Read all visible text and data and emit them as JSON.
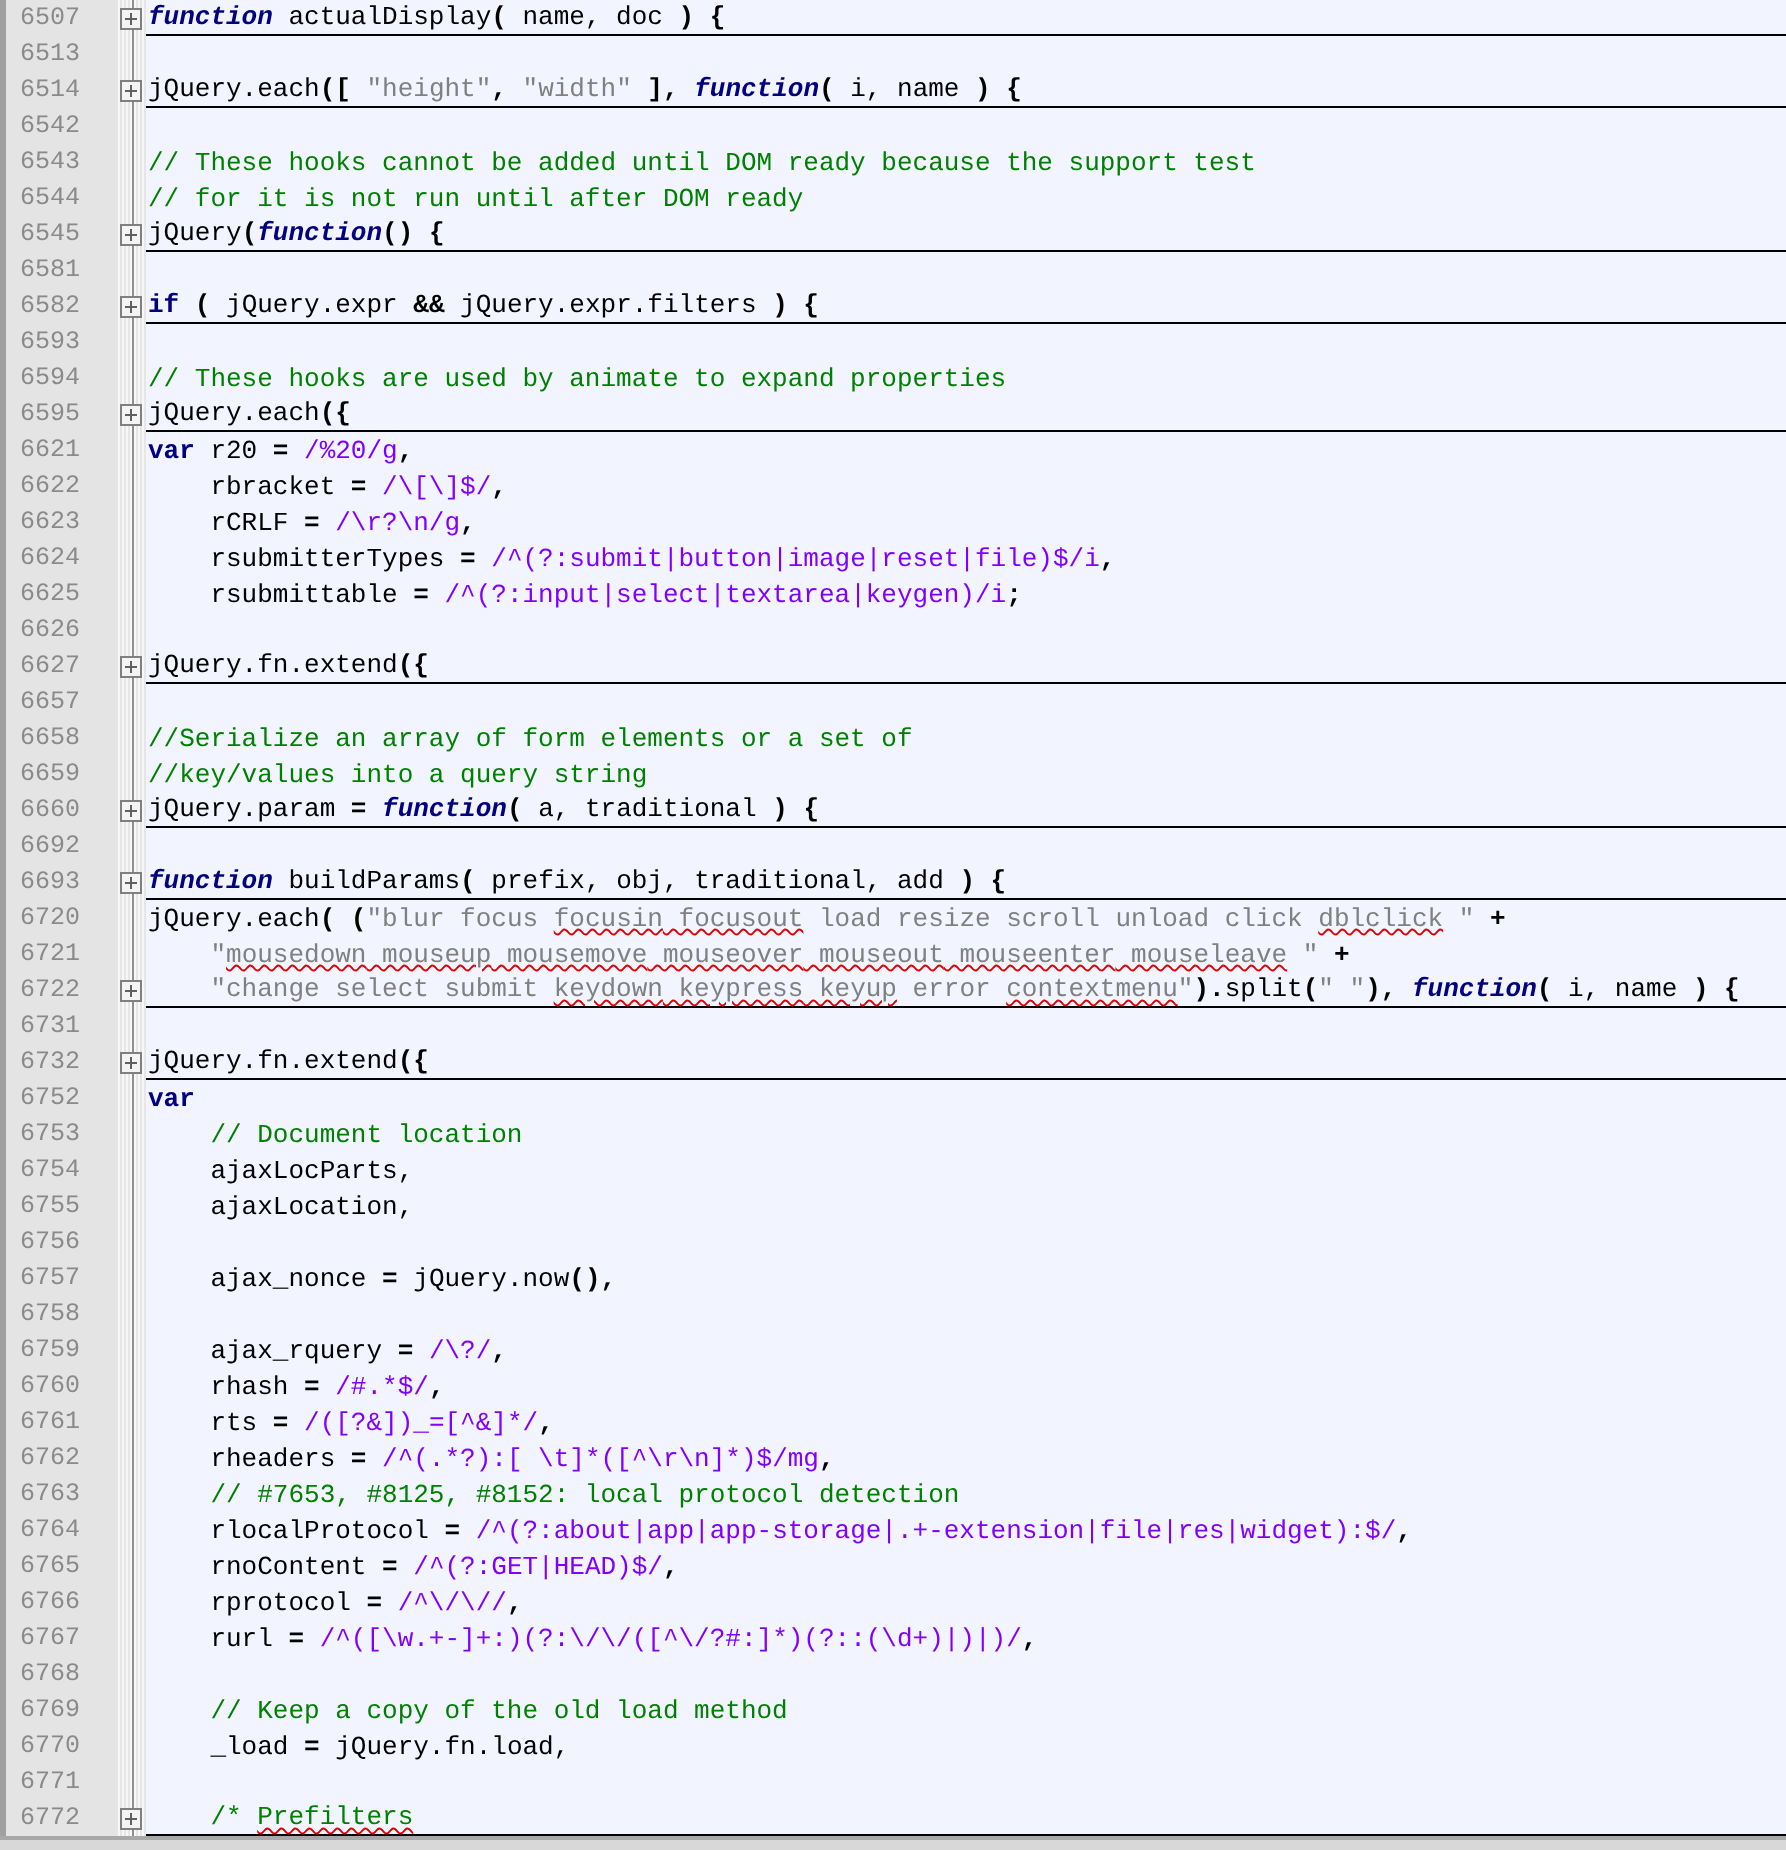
{
  "editor": {
    "lines": [
      {
        "number": "6507",
        "folded": true,
        "tokens": [
          {
            "kind": "fn-keyword",
            "text": "function"
          },
          {
            "kind": "plain",
            "text": " actualDisplay"
          },
          {
            "kind": "op",
            "text": "("
          },
          {
            "kind": "plain",
            "text": " name, doc "
          },
          {
            "kind": "op",
            "text": ") {"
          }
        ]
      },
      {
        "number": "6513",
        "folded": false
      },
      {
        "number": "6514",
        "folded": true,
        "tokens": [
          {
            "kind": "plain",
            "text": "jQuery.each"
          },
          {
            "kind": "op",
            "text": "([ "
          },
          {
            "kind": "string",
            "text": "\"height\""
          },
          {
            "kind": "op",
            "text": ", "
          },
          {
            "kind": "string",
            "text": "\"width\""
          },
          {
            "kind": "op",
            "text": " ], "
          },
          {
            "kind": "fn-keyword",
            "text": "function"
          },
          {
            "kind": "op",
            "text": "("
          },
          {
            "kind": "plain",
            "text": " i, name "
          },
          {
            "kind": "op",
            "text": ") {"
          }
        ]
      },
      {
        "number": "6542",
        "folded": false
      },
      {
        "number": "6543",
        "folded": false,
        "tokens": [
          {
            "kind": "comment",
            "text": "// These hooks cannot be added until DOM ready because the support test"
          }
        ]
      },
      {
        "number": "6544",
        "folded": false,
        "tokens": [
          {
            "kind": "comment",
            "text": "// for it is not run until after DOM ready"
          }
        ]
      },
      {
        "number": "6545",
        "folded": true,
        "tokens": [
          {
            "kind": "plain",
            "text": "jQuery"
          },
          {
            "kind": "op",
            "text": "("
          },
          {
            "kind": "fn-keyword",
            "text": "function"
          },
          {
            "kind": "op",
            "text": "() {"
          }
        ]
      },
      {
        "number": "6581",
        "folded": false
      },
      {
        "number": "6582",
        "folded": true,
        "tokens": [
          {
            "kind": "keyword",
            "text": "if"
          },
          {
            "kind": "op",
            "text": " ("
          },
          {
            "kind": "plain",
            "text": " jQuery.expr "
          },
          {
            "kind": "op",
            "text": "&&"
          },
          {
            "kind": "plain",
            "text": " jQuery.expr.filters "
          },
          {
            "kind": "op",
            "text": ") {"
          }
        ]
      },
      {
        "number": "6593",
        "folded": false
      },
      {
        "number": "6594",
        "folded": false,
        "tokens": [
          {
            "kind": "comment",
            "text": "// These hooks are used by animate to expand properties"
          }
        ]
      },
      {
        "number": "6595",
        "folded": true,
        "tokens": [
          {
            "kind": "plain",
            "text": "jQuery.each"
          },
          {
            "kind": "op",
            "text": "({"
          }
        ]
      },
      {
        "number": "6621",
        "folded": false,
        "tokens": [
          {
            "kind": "keyword",
            "text": "var"
          },
          {
            "kind": "plain",
            "text": " r20 "
          },
          {
            "kind": "op",
            "text": "= "
          },
          {
            "kind": "regex",
            "text": "/%20/g"
          },
          {
            "kind": "op",
            "text": ","
          }
        ]
      },
      {
        "number": "6622",
        "folded": false,
        "tokens": [
          {
            "kind": "plain",
            "text": "    rbracket "
          },
          {
            "kind": "op",
            "text": "= "
          },
          {
            "kind": "regex",
            "text": "/\\[\\]$/"
          },
          {
            "kind": "op",
            "text": ","
          }
        ]
      },
      {
        "number": "6623",
        "folded": false,
        "tokens": [
          {
            "kind": "plain",
            "text": "    rCRLF "
          },
          {
            "kind": "op",
            "text": "= "
          },
          {
            "kind": "regex",
            "text": "/\\r?\\n/g"
          },
          {
            "kind": "op",
            "text": ","
          }
        ]
      },
      {
        "number": "6624",
        "folded": false,
        "tokens": [
          {
            "kind": "plain",
            "text": "    rsubmitterTypes "
          },
          {
            "kind": "op",
            "text": "= "
          },
          {
            "kind": "regex",
            "text": "/^(?:submit|button|image|reset|file)$/i"
          },
          {
            "kind": "op",
            "text": ","
          }
        ]
      },
      {
        "number": "6625",
        "folded": false,
        "tokens": [
          {
            "kind": "plain",
            "text": "    rsubmittable "
          },
          {
            "kind": "op",
            "text": "= "
          },
          {
            "kind": "regex",
            "text": "/^(?:input|select|textarea|keygen)/i"
          },
          {
            "kind": "op",
            "text": ";"
          }
        ]
      },
      {
        "number": "6626",
        "folded": false
      },
      {
        "number": "6627",
        "folded": true,
        "tokens": [
          {
            "kind": "plain",
            "text": "jQuery.fn.extend"
          },
          {
            "kind": "op",
            "text": "({"
          }
        ]
      },
      {
        "number": "6657",
        "folded": false
      },
      {
        "number": "6658",
        "folded": false,
        "tokens": [
          {
            "kind": "comment",
            "text": "//Serialize an array of form elements or a set of"
          }
        ]
      },
      {
        "number": "6659",
        "folded": false,
        "tokens": [
          {
            "kind": "comment",
            "text": "//key/values into a query string"
          }
        ]
      },
      {
        "number": "6660",
        "folded": true,
        "tokens": [
          {
            "kind": "plain",
            "text": "jQuery.param "
          },
          {
            "kind": "op",
            "text": "= "
          },
          {
            "kind": "fn-keyword",
            "text": "function"
          },
          {
            "kind": "op",
            "text": "("
          },
          {
            "kind": "plain",
            "text": " a, traditional "
          },
          {
            "kind": "op",
            "text": ") {"
          }
        ]
      },
      {
        "number": "6692",
        "folded": false
      },
      {
        "number": "6693",
        "folded": true,
        "tokens": [
          {
            "kind": "fn-keyword",
            "text": "function"
          },
          {
            "kind": "plain",
            "text": " buildParams"
          },
          {
            "kind": "op",
            "text": "("
          },
          {
            "kind": "plain",
            "text": " prefix, obj, traditional, add "
          },
          {
            "kind": "op",
            "text": ") {"
          }
        ]
      },
      {
        "number": "6720",
        "folded": false,
        "tokens": [
          {
            "kind": "plain",
            "text": "jQuery.each"
          },
          {
            "kind": "op",
            "text": "( ("
          },
          {
            "kind": "string",
            "text": "\"blur focus "
          },
          {
            "kind": "string-misspelled",
            "text": "focusin"
          },
          {
            "kind": "string-misspelled",
            "text": " focusout"
          },
          {
            "kind": "string",
            "text": " load resize scroll unload click "
          },
          {
            "kind": "string-misspelled",
            "text": "dblclick"
          },
          {
            "kind": "string",
            "text": " \""
          },
          {
            "kind": "op",
            "text": " +"
          }
        ]
      },
      {
        "number": "6721",
        "folded": false,
        "tokens": [
          {
            "kind": "string",
            "text": "    \""
          },
          {
            "kind": "string-misspelled",
            "text": "mousedown"
          },
          {
            "kind": "string-misspelled",
            "text": " mouseup"
          },
          {
            "kind": "string-misspelled",
            "text": " mousemove"
          },
          {
            "kind": "string-misspelled",
            "text": " mouseover"
          },
          {
            "kind": "string-misspelled",
            "text": " mouseout"
          },
          {
            "kind": "string-misspelled",
            "text": " mouseenter"
          },
          {
            "kind": "string-misspelled",
            "text": " mouseleave"
          },
          {
            "kind": "string",
            "text": " \""
          },
          {
            "kind": "op",
            "text": " +"
          }
        ]
      },
      {
        "number": "6722",
        "folded": true,
        "tokens": [
          {
            "kind": "string",
            "text": "    \"change select submit "
          },
          {
            "kind": "string-misspelled",
            "text": "keydown"
          },
          {
            "kind": "string-misspelled",
            "text": " keypress"
          },
          {
            "kind": "string-misspelled",
            "text": " keyup"
          },
          {
            "kind": "string",
            "text": " error "
          },
          {
            "kind": "string-misspelled",
            "text": "contextmenu"
          },
          {
            "kind": "string",
            "text": "\""
          },
          {
            "kind": "op",
            "text": ")."
          },
          {
            "kind": "plain",
            "text": "split"
          },
          {
            "kind": "op",
            "text": "("
          },
          {
            "kind": "string",
            "text": "\" \""
          },
          {
            "kind": "op",
            "text": "), "
          },
          {
            "kind": "fn-keyword",
            "text": "function"
          },
          {
            "kind": "op",
            "text": "("
          },
          {
            "kind": "plain",
            "text": " i, name "
          },
          {
            "kind": "op",
            "text": ") {"
          }
        ]
      },
      {
        "number": "6731",
        "folded": false
      },
      {
        "number": "6732",
        "folded": true,
        "tokens": [
          {
            "kind": "plain",
            "text": "jQuery.fn.extend"
          },
          {
            "kind": "op",
            "text": "({"
          }
        ]
      },
      {
        "number": "6752",
        "folded": false,
        "tokens": [
          {
            "kind": "keyword",
            "text": "var"
          }
        ]
      },
      {
        "number": "6753",
        "folded": false,
        "tokens": [
          {
            "kind": "comment",
            "text": "    // Document location"
          }
        ]
      },
      {
        "number": "6754",
        "folded": false,
        "tokens": [
          {
            "kind": "plain",
            "text": "    ajaxLocParts,"
          }
        ]
      },
      {
        "number": "6755",
        "folded": false,
        "tokens": [
          {
            "kind": "plain",
            "text": "    ajaxLocation,"
          }
        ]
      },
      {
        "number": "6756",
        "folded": false
      },
      {
        "number": "6757",
        "folded": false,
        "tokens": [
          {
            "kind": "plain",
            "text": "    ajax_nonce "
          },
          {
            "kind": "op",
            "text": "="
          },
          {
            "kind": "plain",
            "text": " jQuery.now"
          },
          {
            "kind": "op",
            "text": "(),"
          }
        ]
      },
      {
        "number": "6758",
        "folded": false
      },
      {
        "number": "6759",
        "folded": false,
        "tokens": [
          {
            "kind": "plain",
            "text": "    ajax_rquery "
          },
          {
            "kind": "op",
            "text": "= "
          },
          {
            "kind": "regex",
            "text": "/\\?/"
          },
          {
            "kind": "op",
            "text": ","
          }
        ]
      },
      {
        "number": "6760",
        "folded": false,
        "tokens": [
          {
            "kind": "plain",
            "text": "    rhash "
          },
          {
            "kind": "op",
            "text": "= "
          },
          {
            "kind": "regex",
            "text": "/#.*$/"
          },
          {
            "kind": "op",
            "text": ","
          }
        ]
      },
      {
        "number": "6761",
        "folded": false,
        "tokens": [
          {
            "kind": "plain",
            "text": "    rts "
          },
          {
            "kind": "op",
            "text": "= "
          },
          {
            "kind": "regex",
            "text": "/([?&])_=[^&]*/"
          },
          {
            "kind": "op",
            "text": ","
          }
        ]
      },
      {
        "number": "6762",
        "folded": false,
        "tokens": [
          {
            "kind": "plain",
            "text": "    rheaders "
          },
          {
            "kind": "op",
            "text": "= "
          },
          {
            "kind": "regex",
            "text": "/^(.*?):[ \\t]*([^\\r\\n]*)$/mg"
          },
          {
            "kind": "op",
            "text": ","
          }
        ]
      },
      {
        "number": "6763",
        "folded": false,
        "tokens": [
          {
            "kind": "comment",
            "text": "    // #7653, #8125, #8152: local protocol detection"
          }
        ]
      },
      {
        "number": "6764",
        "folded": false,
        "tokens": [
          {
            "kind": "plain",
            "text": "    rlocalProtocol "
          },
          {
            "kind": "op",
            "text": "= "
          },
          {
            "kind": "regex",
            "text": "/^(?:about|app|app-storage|.+-extension|file|res|widget):$/"
          },
          {
            "kind": "op",
            "text": ","
          }
        ]
      },
      {
        "number": "6765",
        "folded": false,
        "tokens": [
          {
            "kind": "plain",
            "text": "    rnoContent "
          },
          {
            "kind": "op",
            "text": "= "
          },
          {
            "kind": "regex",
            "text": "/^(?:GET|HEAD)$/"
          },
          {
            "kind": "op",
            "text": ","
          }
        ]
      },
      {
        "number": "6766",
        "folded": false,
        "tokens": [
          {
            "kind": "plain",
            "text": "    rprotocol "
          },
          {
            "kind": "op",
            "text": "= "
          },
          {
            "kind": "regex",
            "text": "/^\\/\\//"
          },
          {
            "kind": "op",
            "text": ","
          }
        ]
      },
      {
        "number": "6767",
        "folded": false,
        "tokens": [
          {
            "kind": "plain",
            "text": "    rurl "
          },
          {
            "kind": "op",
            "text": "= "
          },
          {
            "kind": "regex",
            "text": "/^([\\w.+-]+:)(?:\\/\\/([^\\/?#:]*)(?::(\\d+)|)|)/"
          },
          {
            "kind": "op",
            "text": ","
          }
        ]
      },
      {
        "number": "6768",
        "folded": false
      },
      {
        "number": "6769",
        "folded": false,
        "tokens": [
          {
            "kind": "comment",
            "text": "    // Keep a copy of the old load method"
          }
        ]
      },
      {
        "number": "6770",
        "folded": false,
        "tokens": [
          {
            "kind": "plain",
            "text": "    _load "
          },
          {
            "kind": "op",
            "text": "="
          },
          {
            "kind": "plain",
            "text": " jQuery.fn.load,"
          }
        ]
      },
      {
        "number": "6771",
        "folded": false
      },
      {
        "number": "6772",
        "folded": true,
        "tokens": [
          {
            "kind": "comment",
            "text": "    /* "
          },
          {
            "kind": "comment-misspelled",
            "text": "Prefilters"
          }
        ]
      }
    ]
  }
}
